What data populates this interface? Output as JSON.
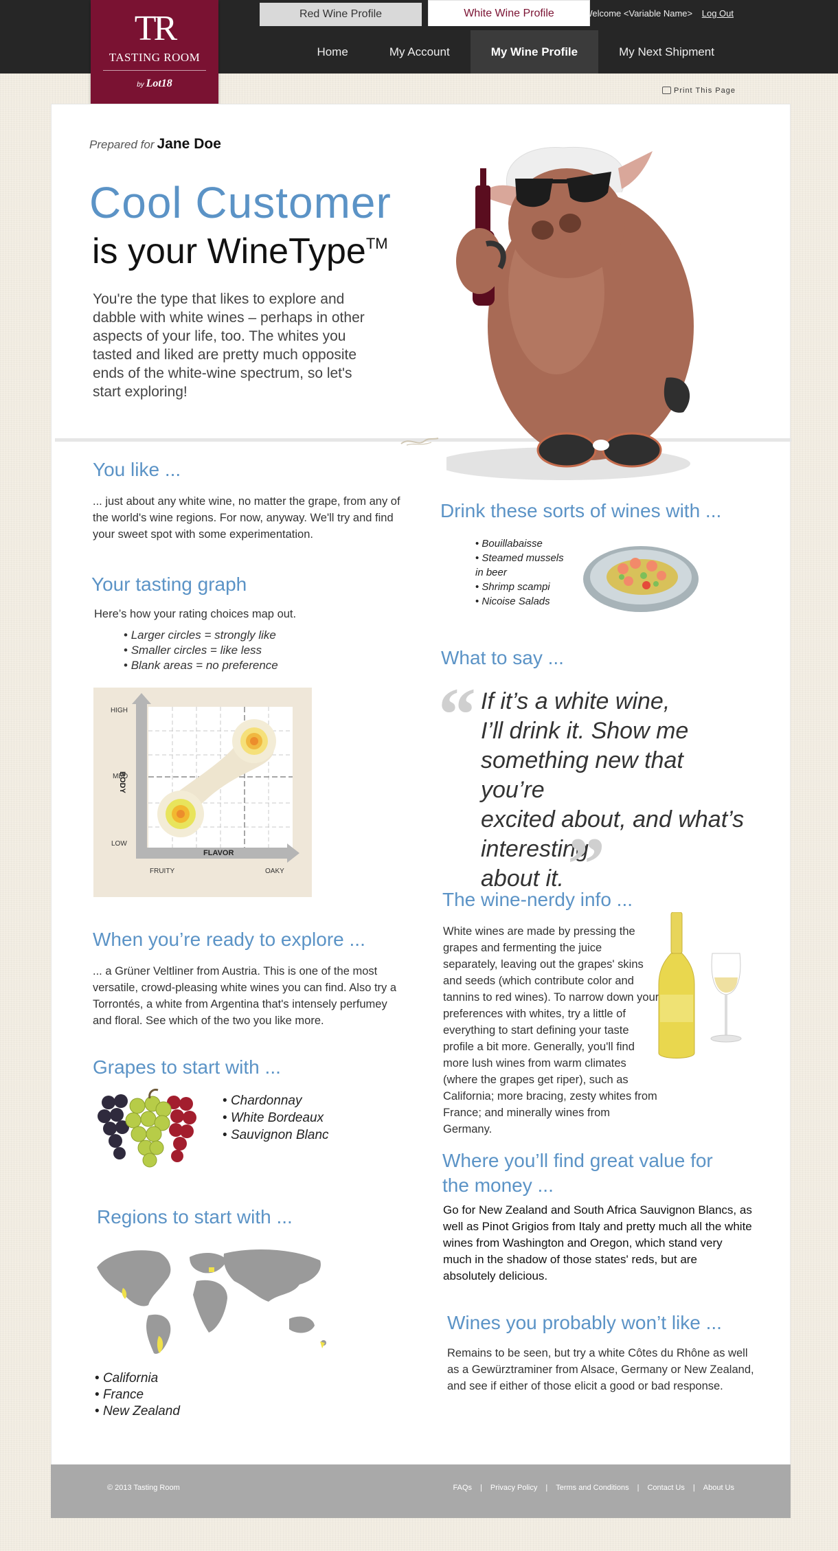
{
  "header": {
    "welcome_text": "Welcome <Variable Name>",
    "logout_label": "Log Out",
    "logo": {
      "monogram": "TR",
      "brand": "TASTING ROOM",
      "by": "by",
      "partner": "Lot18"
    },
    "nav": [
      {
        "label": "Home",
        "active": false
      },
      {
        "label": "My Account",
        "active": false
      },
      {
        "label": "My Wine Profile",
        "active": true
      },
      {
        "label": "My Next Shipment",
        "active": false
      }
    ]
  },
  "tabs": {
    "red": "Red Wine Profile",
    "white": "White Wine Profile",
    "print": "Print This Page"
  },
  "profile": {
    "prepared_for_label": "Prepared for",
    "customer_name": "Jane Doe",
    "type_title": "Cool Customer",
    "type_subtitle": "is your WineType",
    "trademark": "TM",
    "intro": "You're the type that likes to explore and dabble with white wines – perhaps in other aspects of your life, too. The whites you tasted and liked are pretty much opposite ends of the white-wine spectrum, so let's start exploring!"
  },
  "you_like": {
    "heading": "You like ...",
    "text": "... just about any white wine, no matter the grape, from any of the world's wine regions. For now, anyway. We'll try and find your sweet spot with some experimentation."
  },
  "tasting_graph": {
    "heading": "Your tasting graph",
    "intro": "Here’s how your rating choices map out.",
    "bullets": [
      "Larger circles = strongly like",
      "Smaller circles = like less",
      "Blank areas = no preference"
    ],
    "labels": {
      "high": "HIGH",
      "med": "MED",
      "low": "LOW",
      "body": "BODY",
      "flavor": "FLAVOR",
      "fruity": "FRUITY",
      "oaky": "OAKY"
    }
  },
  "explore": {
    "heading": "When you’re ready to explore ...",
    "text": "... a Grüner Veltliner from Austria. This is one of the most versatile, crowd-pleasing white wines you can find. Also try a Torrontés, a white from Argentina that's intensely perfumey and floral. See which of the two you like more."
  },
  "grapes": {
    "heading": "Grapes to start with ...",
    "items": [
      "Chardonnay",
      "White Bordeaux",
      "Sauvignon Blanc"
    ]
  },
  "regions": {
    "heading": "Regions to start with ...",
    "items": [
      "California",
      "France",
      "New Zealand"
    ]
  },
  "pairings": {
    "heading": "Drink these sorts of wines with ...",
    "items": [
      "Bouillabaisse",
      "Steamed mussels in beer",
      "Shrimp scampi",
      "Nicoise Salads"
    ]
  },
  "what_to_say": {
    "heading": "What to say ...",
    "quote_lines": [
      "If it’s a white wine,",
      "I’ll drink it. Show me",
      "something new that you’re",
      "excited about, and what’s",
      "interesting",
      "about it."
    ]
  },
  "nerdy": {
    "heading": "The wine-nerdy info ...",
    "text": "White wines are made by pressing the grapes and fermenting the juice separately, leaving out the grapes' skins and seeds (which contribute color and tannins to red wines). To narrow down your preferences with whites, try a little of everything to start defining your taste profile a bit more. Generally, you'll find more lush wines from warm climates (where the grapes get riper), such as California; more bracing, zesty whites from France; and minerally wines from Germany."
  },
  "value": {
    "heading": "Where you’ll find great value for the money ...",
    "text": "Go for New Zealand and South Africa Sauvignon Blancs, as well as Pinot Grigios from Italy and pretty much all the white wines from Washington and Oregon, which stand very much in the shadow of those states' reds, but are absolutely delicious."
  },
  "wont_like": {
    "heading": "Wines you probably won’t like ...",
    "text": "Remains to be seen, but try a white Côtes du Rhône as well as a Gewürztraminer from Alsace, Germany or New Zealand, and see if either of those elicit a good or bad response."
  },
  "footer": {
    "copyright": "© 2013 Tasting Room",
    "links": [
      "FAQs",
      "Privacy Policy",
      "Terms and Conditions",
      "Contact Us",
      "About Us"
    ]
  },
  "colors": {
    "brand": "#7a1232",
    "accent_blue": "#5b93c6",
    "topbar": "#262626",
    "footer": "#a9a9a9"
  }
}
